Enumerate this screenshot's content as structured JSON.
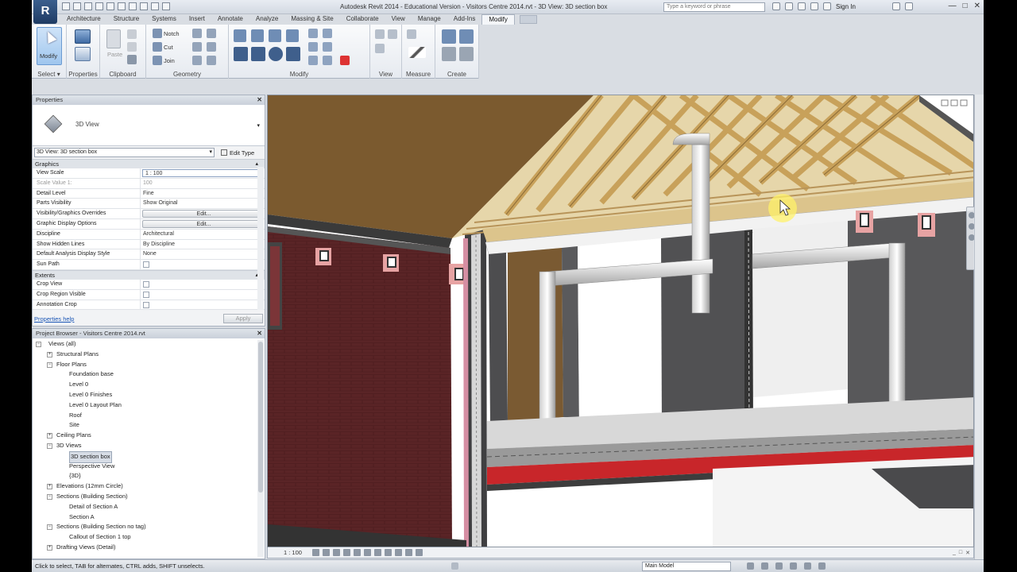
{
  "app": {
    "logo_letter": "R",
    "title": "Autodesk Revit 2014 - Educational Version -   Visitors Centre 2014.rvt - 3D View: 3D section box",
    "search_placeholder": "Type a keyword or phrase",
    "sign_in": "Sign In",
    "window_controls": [
      "—",
      "□",
      "✕"
    ]
  },
  "ribbon": {
    "tabs": [
      {
        "label": "Architecture",
        "active": false
      },
      {
        "label": "Structure",
        "active": false
      },
      {
        "label": "Systems",
        "active": false
      },
      {
        "label": "Insert",
        "active": false
      },
      {
        "label": "Annotate",
        "active": false
      },
      {
        "label": "Analyze",
        "active": false
      },
      {
        "label": "Massing & Site",
        "active": false
      },
      {
        "label": "Collaborate",
        "active": false
      },
      {
        "label": "View",
        "active": false
      },
      {
        "label": "Manage",
        "active": false
      },
      {
        "label": "Add-Ins",
        "active": false
      },
      {
        "label": "Modify",
        "active": true
      }
    ],
    "modify_label": "Modify",
    "select_label": "Select ▾",
    "properties_label": "Properties",
    "clipboard_label": "Clipboard",
    "paste_label": "Paste",
    "geometry_label": "Geometry",
    "notch_label": "Notch",
    "cut_label": "Cut",
    "join_label": "Join",
    "modify_group_label": "Modify",
    "view_label": "View",
    "measure_label": "Measure",
    "create_label": "Create"
  },
  "properties": {
    "title": "Properties",
    "type_name": "3D View",
    "instance_selector": "3D View: 3D section box",
    "edit_type": "Edit Type",
    "groups": {
      "graphics": "Graphics",
      "extents": "Extents"
    },
    "graphics_rows": [
      {
        "key": "View Scale",
        "value": "1 : 100",
        "style": "box"
      },
      {
        "key": "Scale Value    1:",
        "value": "100",
        "style": "dim"
      },
      {
        "key": "Detail Level",
        "value": "Fine",
        "style": ""
      },
      {
        "key": "Parts Visibility",
        "value": "Show Original",
        "style": ""
      },
      {
        "key": "Visibility/Graphics Overrides",
        "value": "Edit...",
        "style": "btn"
      },
      {
        "key": "Graphic Display Options",
        "value": "Edit...",
        "style": "btn"
      },
      {
        "key": "Discipline",
        "value": "Architectural",
        "style": ""
      },
      {
        "key": "Show Hidden Lines",
        "value": "By Discipline",
        "style": ""
      },
      {
        "key": "Default Analysis Display Style",
        "value": "None",
        "style": ""
      },
      {
        "key": "Sun Path",
        "value": "",
        "style": "chk"
      }
    ],
    "extents_rows": [
      {
        "key": "Crop View",
        "value": "",
        "style": "chk"
      },
      {
        "key": "Crop Region Visible",
        "value": "",
        "style": "chk"
      },
      {
        "key": "Annotation Crop",
        "value": "",
        "style": "chk"
      }
    ],
    "help_link": "Properties help",
    "apply": "Apply"
  },
  "browser": {
    "title": "Project Browser - Visitors Centre 2014.rvt",
    "items": [
      {
        "label": "Views (all)",
        "level": 0,
        "exp": "−",
        "selected": false
      },
      {
        "label": "Structural Plans",
        "level": 1,
        "exp": "+",
        "selected": false
      },
      {
        "label": "Floor Plans",
        "level": 1,
        "exp": "−",
        "selected": false
      },
      {
        "label": "Foundation base",
        "level": 2,
        "exp": "",
        "selected": false
      },
      {
        "label": "Level 0",
        "level": 2,
        "exp": "",
        "selected": false
      },
      {
        "label": "Level 0 Finishes",
        "level": 2,
        "exp": "",
        "selected": false
      },
      {
        "label": "Level 0 Layout Plan",
        "level": 2,
        "exp": "",
        "selected": false
      },
      {
        "label": "Roof",
        "level": 2,
        "exp": "",
        "selected": false
      },
      {
        "label": "Site",
        "level": 2,
        "exp": "",
        "selected": false
      },
      {
        "label": "Ceiling Plans",
        "level": 1,
        "exp": "+",
        "selected": false
      },
      {
        "label": "3D Views",
        "level": 1,
        "exp": "−",
        "selected": false
      },
      {
        "label": "3D section box",
        "level": 2,
        "exp": "",
        "selected": true
      },
      {
        "label": "Perspective View",
        "level": 2,
        "exp": "",
        "selected": false
      },
      {
        "label": "{3D}",
        "level": 2,
        "exp": "",
        "selected": false
      },
      {
        "label": "Elevations (12mm Circle)",
        "level": 1,
        "exp": "+",
        "selected": false
      },
      {
        "label": "Sections (Building Section)",
        "level": 1,
        "exp": "−",
        "selected": false
      },
      {
        "label": "Detail of Section A",
        "level": 2,
        "exp": "",
        "selected": false
      },
      {
        "label": "Section A",
        "level": 2,
        "exp": "",
        "selected": false
      },
      {
        "label": "Sections (Building Section no tag)",
        "level": 1,
        "exp": "−",
        "selected": false
      },
      {
        "label": "Callout of Section 1 top",
        "level": 2,
        "exp": "",
        "selected": false
      },
      {
        "label": "Drafting Views (Detail)",
        "level": 1,
        "exp": "+",
        "selected": false
      }
    ]
  },
  "viewport": {
    "scale": "1 : 100",
    "controls": [
      "_",
      "□",
      "✕"
    ]
  },
  "status": {
    "hint": "Click to select, TAB for alternates, CTRL adds, SHIFT unselects.",
    "model": "Main Model"
  },
  "colors": {
    "brick": "#5a2426",
    "roof_wood": "#c9a56a",
    "slab_red": "#c8262a",
    "wall_gray": "#4e4e50",
    "ribbon_blue": "#9fc6ee"
  }
}
